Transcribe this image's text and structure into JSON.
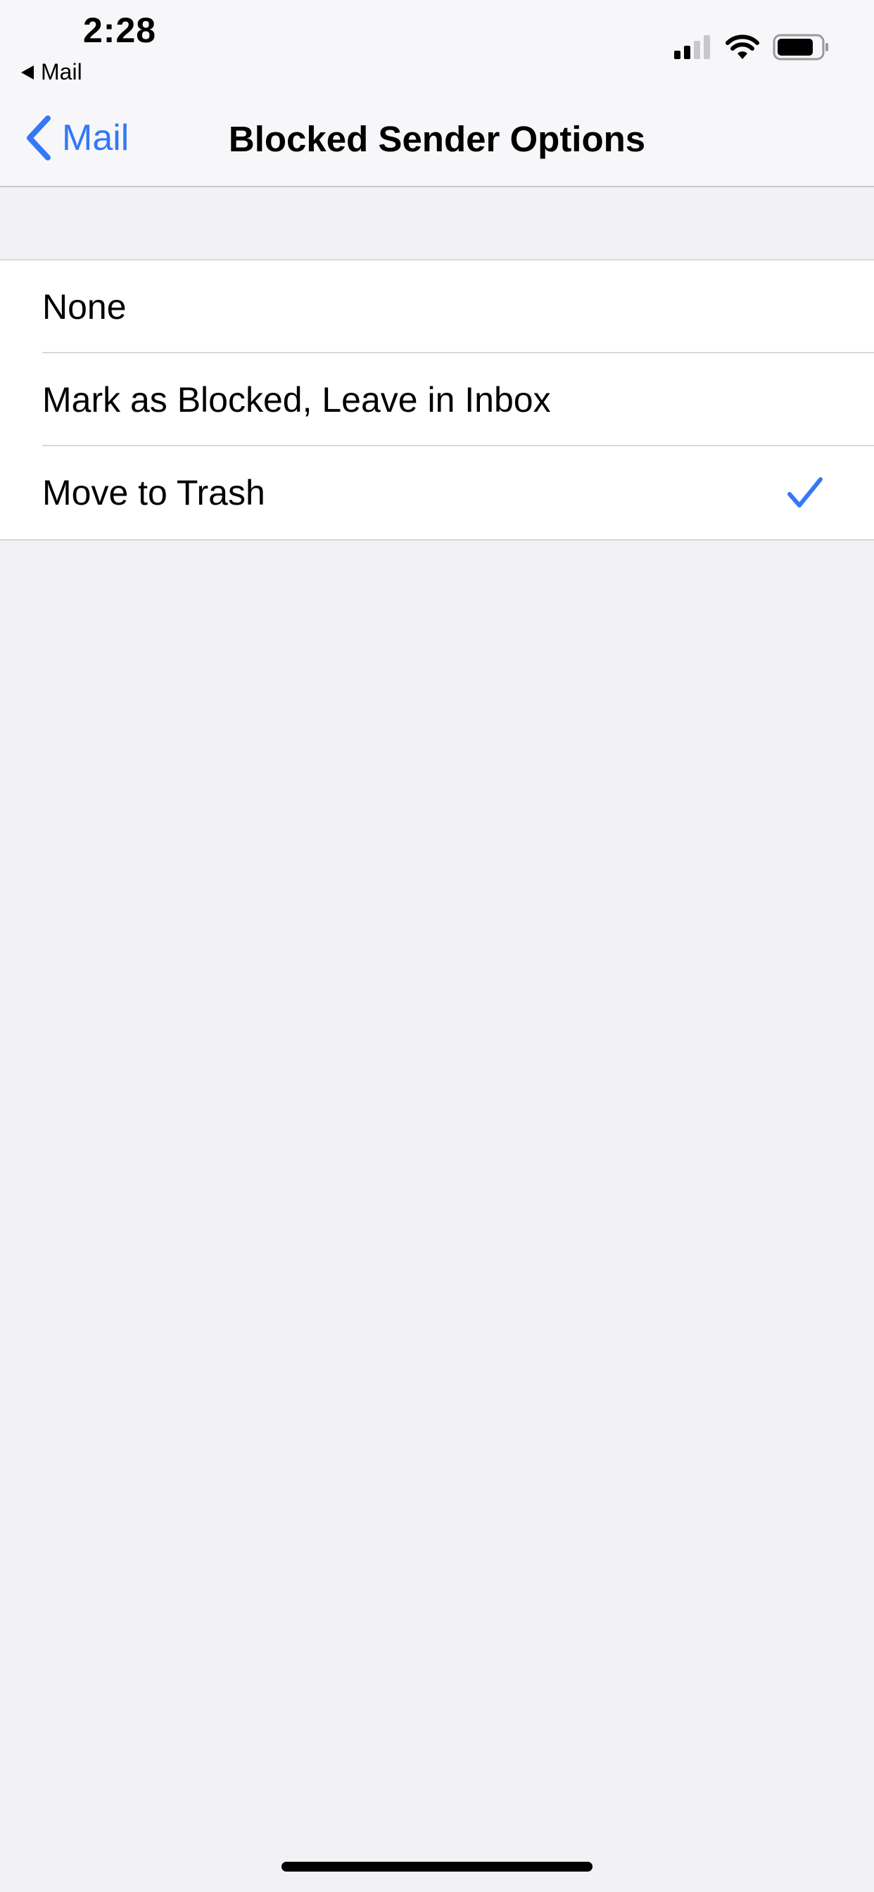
{
  "status_bar": {
    "time": "2:28",
    "back_app_label": "Mail",
    "signal_icon": "cellular-signal-icon",
    "wifi_icon": "wifi-icon",
    "battery_icon": "battery-icon"
  },
  "nav": {
    "back_label": "Mail",
    "back_icon": "chevron-left-icon",
    "title": "Blocked Sender Options"
  },
  "options": [
    {
      "label": "None",
      "selected": false
    },
    {
      "label": "Mark as Blocked, Leave in Inbox",
      "selected": false
    },
    {
      "label": "Move to Trash",
      "selected": true
    }
  ],
  "colors": {
    "accent": "#3478f6",
    "background": "#f1f1f6",
    "cell": "#ffffff"
  }
}
